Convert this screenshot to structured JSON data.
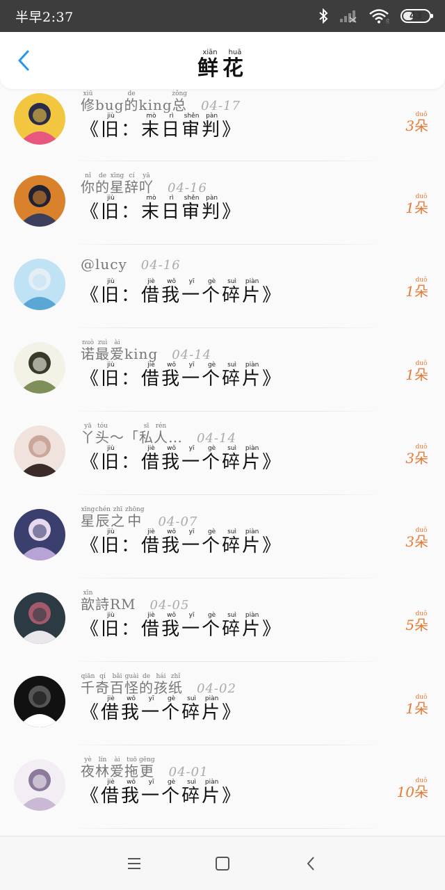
{
  "status_bar": {
    "time": "半早2:37",
    "battery": "43",
    "battery_level": 0.43,
    "icons": [
      "bluetooth-icon",
      "signal-icon",
      "wifi-icon",
      "battery-icon"
    ]
  },
  "header": {
    "title_chars": [
      "鲜",
      "花"
    ],
    "title_pinyin": [
      "xiān",
      "huā"
    ],
    "back_icon": "chevron-left-icon"
  },
  "accent_colors": {
    "back": "#2196f3",
    "count": "#e87a34"
  },
  "items": [
    {
      "name": [
        [
          "修",
          "xiū"
        ],
        [
          "bug",
          ""
        ],
        [
          "的",
          "de"
        ],
        [
          "king",
          ""
        ],
        [
          "总",
          "zǒng"
        ]
      ],
      "date": "04-17",
      "content": [
        [
          "《",
          ""
        ],
        [
          "旧",
          "jiù"
        ],
        [
          "：",
          ""
        ],
        [
          "末",
          "mò"
        ],
        [
          "日",
          "rì"
        ],
        [
          "审",
          "shěn"
        ],
        [
          "判",
          "pàn"
        ],
        [
          "》",
          ""
        ]
      ],
      "count": "3",
      "unit": "朵",
      "unit_pinyin": "duǒ",
      "avatar_colors": [
        "#f3c640",
        "#e8577d",
        "#2b2b4a"
      ]
    },
    {
      "name": [
        [
          "你",
          "nǐ"
        ],
        [
          "的",
          "de"
        ],
        [
          "星",
          "xīng"
        ],
        [
          "辞",
          "cí"
        ],
        [
          "吖",
          "yā"
        ]
      ],
      "date": "04-16",
      "content": [
        [
          "《",
          ""
        ],
        [
          "旧",
          "jiù"
        ],
        [
          "：",
          ""
        ],
        [
          "末",
          "mò"
        ],
        [
          "日",
          "rì"
        ],
        [
          "审",
          "shěn"
        ],
        [
          "判",
          "pàn"
        ],
        [
          "》",
          ""
        ]
      ],
      "count": "1",
      "unit": "朵",
      "unit_pinyin": "duǒ",
      "avatar_colors": [
        "#d9822b",
        "#3b3f5c",
        "#1f2233"
      ]
    },
    {
      "name": [
        [
          "@lucy",
          ""
        ]
      ],
      "date": "04-16",
      "content": [
        [
          "《",
          ""
        ],
        [
          "旧",
          "jiù"
        ],
        [
          "：",
          ""
        ],
        [
          "借",
          "jiè"
        ],
        [
          "我",
          "wǒ"
        ],
        [
          "一",
          "yī"
        ],
        [
          "个",
          "gè"
        ],
        [
          "碎",
          "suì"
        ],
        [
          "片",
          "piàn"
        ],
        [
          "》",
          ""
        ]
      ],
      "count": "1",
      "unit": "朵",
      "unit_pinyin": "duǒ",
      "avatar_colors": [
        "#bfe3f5",
        "#5aa7d6",
        "#e6eef5"
      ]
    },
    {
      "name": [
        [
          "诺",
          "nuò"
        ],
        [
          "最",
          "zuì"
        ],
        [
          "爱",
          "ài"
        ],
        [
          "king",
          ""
        ]
      ],
      "date": "04-14",
      "content": [
        [
          "《",
          ""
        ],
        [
          "旧",
          "jiù"
        ],
        [
          "：",
          ""
        ],
        [
          "借",
          "jiè"
        ],
        [
          "我",
          "wǒ"
        ],
        [
          "一",
          "yī"
        ],
        [
          "个",
          "gè"
        ],
        [
          "碎",
          "suì"
        ],
        [
          "片",
          "piàn"
        ],
        [
          "》",
          ""
        ]
      ],
      "count": "1",
      "unit": "朵",
      "unit_pinyin": "duǒ",
      "avatar_colors": [
        "#f4f1e6",
        "#7f8f5a",
        "#3a3a2a"
      ]
    },
    {
      "name": [
        [
          "丫",
          "yā"
        ],
        [
          "头",
          "tóu"
        ],
        [
          "～「",
          ""
        ],
        [
          "私",
          "sī"
        ],
        [
          "人",
          "rén"
        ],
        [
          "…",
          ""
        ]
      ],
      "date": "04-14",
      "content": [
        [
          "《",
          ""
        ],
        [
          "旧",
          "jiù"
        ],
        [
          "：",
          ""
        ],
        [
          "借",
          "jiè"
        ],
        [
          "我",
          "wǒ"
        ],
        [
          "一",
          "yī"
        ],
        [
          "个",
          "gè"
        ],
        [
          "碎",
          "suì"
        ],
        [
          "片",
          "piàn"
        ],
        [
          "》",
          ""
        ]
      ],
      "count": "3",
      "unit": "朵",
      "unit_pinyin": "duǒ",
      "avatar_colors": [
        "#f0e2dc",
        "#3a2a28",
        "#c9a59a"
      ]
    },
    {
      "name": [
        [
          "星",
          "xīng"
        ],
        [
          "辰",
          "chén"
        ],
        [
          "之",
          "zhī"
        ],
        [
          "中",
          "zhōng"
        ]
      ],
      "date": "04-07",
      "content": [
        [
          "《",
          ""
        ],
        [
          "旧",
          "jiù"
        ],
        [
          "：",
          ""
        ],
        [
          "借",
          "jiè"
        ],
        [
          "我",
          "wǒ"
        ],
        [
          "一",
          "yī"
        ],
        [
          "个",
          "gè"
        ],
        [
          "碎",
          "suì"
        ],
        [
          "片",
          "piàn"
        ],
        [
          "》",
          ""
        ]
      ],
      "count": "3",
      "unit": "朵",
      "unit_pinyin": "duǒ",
      "avatar_colors": [
        "#3a3f6e",
        "#b7a3d6",
        "#e9d9ef"
      ]
    },
    {
      "name": [
        [
          "歆",
          "xīn"
        ],
        [
          "詩RM",
          ""
        ]
      ],
      "date": "04-05",
      "content": [
        [
          "《",
          ""
        ],
        [
          "旧",
          "jiù"
        ],
        [
          "：",
          ""
        ],
        [
          "借",
          "jiè"
        ],
        [
          "我",
          "wǒ"
        ],
        [
          "一",
          "yī"
        ],
        [
          "个",
          "gè"
        ],
        [
          "碎",
          "suì"
        ],
        [
          "片",
          "piàn"
        ],
        [
          "》",
          ""
        ]
      ],
      "count": "5",
      "unit": "朵",
      "unit_pinyin": "duǒ",
      "avatar_colors": [
        "#2c3a44",
        "#e9e6ec",
        "#a55a6b"
      ]
    },
    {
      "name": [
        [
          "千",
          "qiān"
        ],
        [
          "奇",
          "qí"
        ],
        [
          "百",
          "bǎi"
        ],
        [
          "怪",
          "guài"
        ],
        [
          "的",
          "de"
        ],
        [
          "孩",
          "hái"
        ],
        [
          "纸",
          "zhǐ"
        ]
      ],
      "date": "04-02",
      "content": [
        [
          "《",
          ""
        ],
        [
          "借",
          "jiè"
        ],
        [
          "我",
          "wǒ"
        ],
        [
          "一",
          "yī"
        ],
        [
          "个",
          "gè"
        ],
        [
          "碎",
          "suì"
        ],
        [
          "片",
          "piàn"
        ],
        [
          "》",
          ""
        ]
      ],
      "count": "1",
      "unit": "朵",
      "unit_pinyin": "duǒ",
      "avatar_colors": [
        "#111111",
        "#ffffff",
        "#555555"
      ]
    },
    {
      "name": [
        [
          "夜",
          "yè"
        ],
        [
          "林",
          "lín"
        ],
        [
          "爱",
          "ài"
        ],
        [
          "拖",
          "tuō"
        ],
        [
          "更",
          "gēng"
        ]
      ],
      "date": "04-01",
      "content": [
        [
          "《",
          ""
        ],
        [
          "借",
          "jiè"
        ],
        [
          "我",
          "wǒ"
        ],
        [
          "一",
          "yī"
        ],
        [
          "个",
          "gè"
        ],
        [
          "碎",
          "suì"
        ],
        [
          "片",
          "piàn"
        ],
        [
          "》",
          ""
        ]
      ],
      "count": "10",
      "unit": "朵",
      "unit_pinyin": "duǒ",
      "avatar_colors": [
        "#f3eef3",
        "#c9b9d4",
        "#8b7a9c"
      ]
    }
  ],
  "nav_bar": {
    "buttons": [
      "menu-icon",
      "home-square-icon",
      "back-triangle-icon"
    ]
  }
}
